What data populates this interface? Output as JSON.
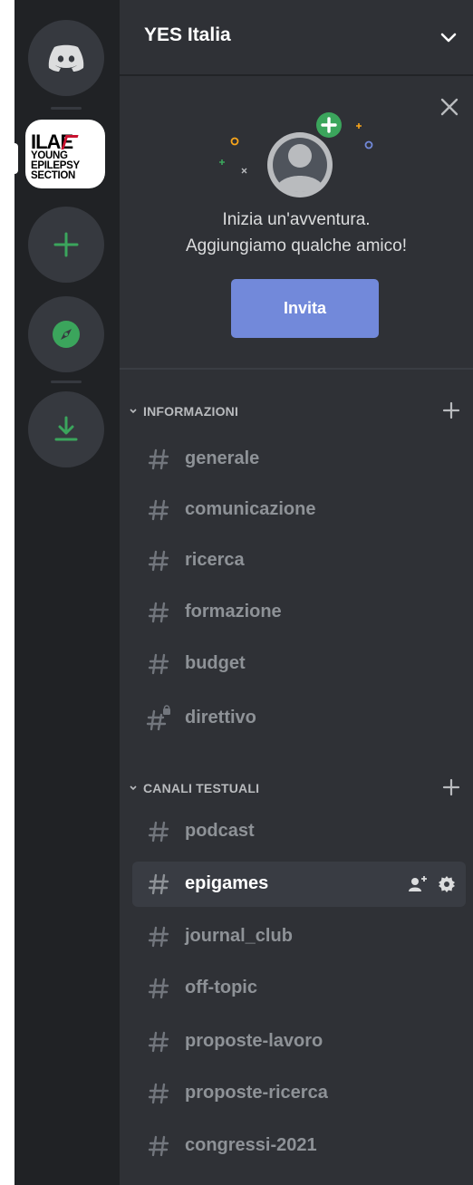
{
  "server": {
    "name": "YES Italia",
    "logo": {
      "line1": "ILAE",
      "line2": "YOUNG",
      "line3": "EPILEPSY",
      "line4": "SECTION"
    }
  },
  "rail": {
    "icons": [
      "discord-home-icon",
      "plus-icon",
      "compass-icon",
      "download-icon"
    ],
    "accent": "#3ba55c"
  },
  "invite": {
    "line1": "Inizia un'avventura.",
    "line2": "Aggiungiamo qualche amico!",
    "button_label": "Invita",
    "button_color": "#7289da"
  },
  "categories": [
    {
      "label": "INFORMAZIONI",
      "channels": [
        {
          "name": "generale",
          "locked": false
        },
        {
          "name": "comunicazione",
          "locked": false
        },
        {
          "name": "ricerca",
          "locked": false
        },
        {
          "name": "formazione",
          "locked": false
        },
        {
          "name": "budget",
          "locked": false
        },
        {
          "name": "direttivo",
          "locked": true
        }
      ]
    },
    {
      "label": "CANALI TESTUALI",
      "channels": [
        {
          "name": "podcast",
          "active": false
        },
        {
          "name": "epigames",
          "active": true
        },
        {
          "name": "journal_club",
          "active": false
        },
        {
          "name": "off-topic",
          "active": false
        },
        {
          "name": "proposte-lavoro",
          "active": false
        },
        {
          "name": "proposte-ricerca",
          "active": false
        },
        {
          "name": "congressi-2021",
          "active": false
        }
      ]
    }
  ]
}
